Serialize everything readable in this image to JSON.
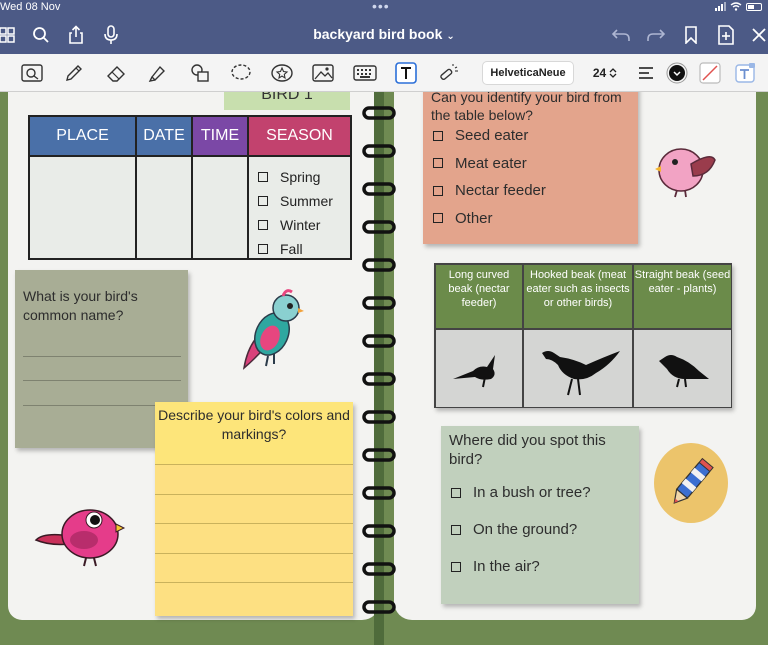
{
  "status": {
    "time": "Wed 08 Nov",
    "dots": "•••"
  },
  "header": {
    "title": "backyard bird book"
  },
  "toolbar": {
    "font": "HelveticaNeue",
    "size": "24"
  },
  "header_strip": "BIRD 1",
  "table": {
    "headers": [
      {
        "label": "PLACE",
        "color": "#4a70a8"
      },
      {
        "label": "DATE",
        "color": "#4a70a8"
      },
      {
        "label": "TIME",
        "color": "#7b48a6"
      },
      {
        "label": "SEASON",
        "color": "#c2426e"
      }
    ],
    "seasons": [
      "Spring",
      "Summer",
      "Winter",
      "Fall"
    ]
  },
  "common_name": {
    "question": "What is your bird's common name?"
  },
  "colors_markings": {
    "question": "Describe your bird's colors and markings?"
  },
  "identify": {
    "question": "Can you identify your bird from the table below?",
    "options": [
      "Seed eater",
      "Meat eater",
      "Nectar feeder",
      "Other"
    ]
  },
  "beaks": [
    {
      "label": "Long curved beak (nectar feeder)"
    },
    {
      "label": "Hooked beak (meat eater such as insects or other birds)"
    },
    {
      "label": "Straight beak (seed eater - plants)"
    }
  ],
  "spot": {
    "question": "Where did you spot this bird?",
    "options": [
      "In a bush or tree?",
      "On the ground?",
      "In the air?"
    ]
  },
  "colors": {
    "chrome": "#4c5a86",
    "page_green": "#6f8a52",
    "beak_header": "#6b8b4a"
  }
}
